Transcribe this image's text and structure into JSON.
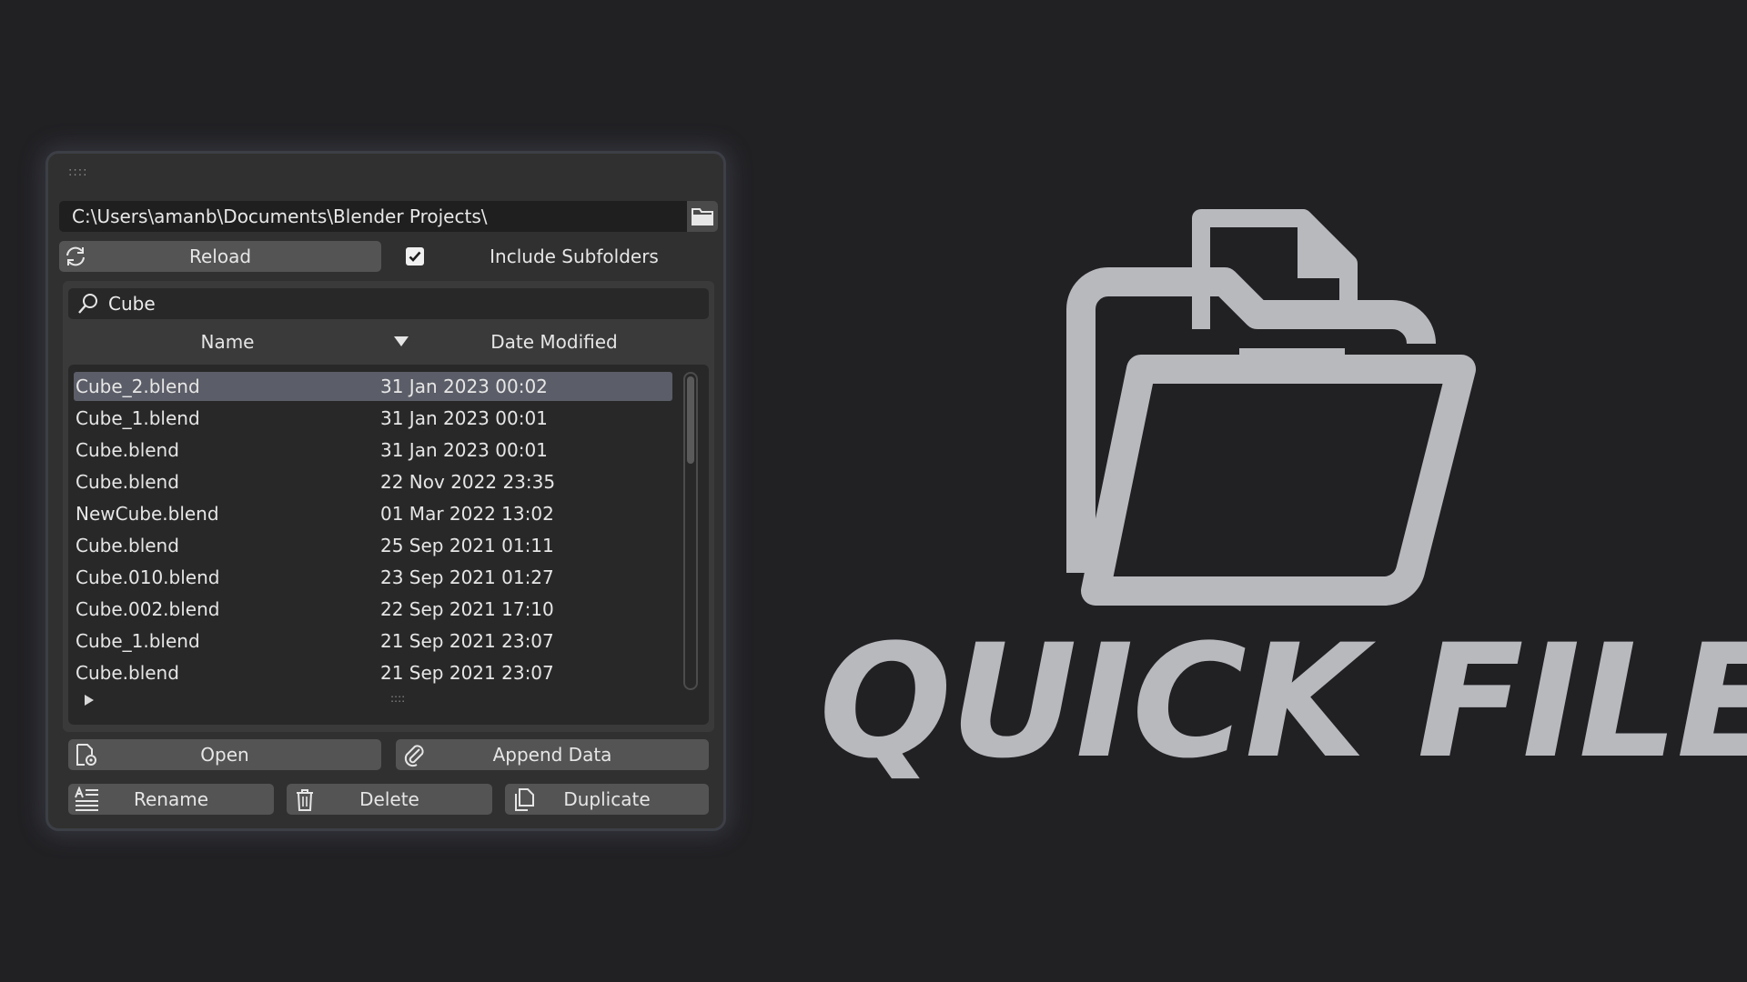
{
  "panel": {
    "path": "C:\\Users\\amanb\\Documents\\Blender Projects\\",
    "reload_label": "Reload",
    "include_subfolders_label": "Include Subfolders",
    "include_subfolders_checked": true,
    "search_value": "Cube",
    "columns": {
      "name": "Name",
      "date": "Date Modified"
    },
    "files": [
      {
        "name": "Cube_2.blend",
        "date": "31 Jan 2023 00:02",
        "selected": true
      },
      {
        "name": "Cube_1.blend",
        "date": "31 Jan 2023 00:01"
      },
      {
        "name": "Cube.blend",
        "date": "31 Jan 2023 00:01"
      },
      {
        "name": "Cube.blend",
        "date": "22 Nov 2022 23:35"
      },
      {
        "name": "NewCube.blend",
        "date": "01 Mar 2022 13:02"
      },
      {
        "name": "Cube.blend",
        "date": "25 Sep 2021 01:11"
      },
      {
        "name": "Cube.010.blend",
        "date": "23 Sep 2021 01:27"
      },
      {
        "name": "Cube.002.blend",
        "date": "22 Sep 2021 17:10"
      },
      {
        "name": "Cube_1.blend",
        "date": "21 Sep 2021 23:07"
      },
      {
        "name": "Cube.blend",
        "date": "21 Sep 2021 23:07"
      }
    ],
    "buttons": {
      "open": "Open",
      "append": "Append Data",
      "rename": "Rename",
      "delete": "Delete",
      "duplicate": "Duplicate"
    },
    "icons": [
      "folder-browse-icon",
      "reload-icon",
      "checkmark-icon",
      "search-icon",
      "sort-down-icon",
      "expand-arrow-icon",
      "open-file-icon",
      "paperclip-icon",
      "rename-icon",
      "trash-icon",
      "duplicate-icon"
    ]
  },
  "brand": {
    "title": "QUICK FILES",
    "color": "#b8b9bd"
  },
  "colors": {
    "background": "#212124",
    "panel": "#303030",
    "field": "#1f1f1f",
    "button": "#545454",
    "selection": "#5b5d68"
  }
}
